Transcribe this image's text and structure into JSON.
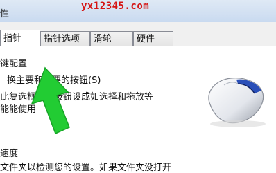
{
  "window": {
    "title_fragment": "性"
  },
  "watermark": "yx12345.com",
  "tabs": [
    {
      "label": "指针"
    },
    {
      "label": "指针选项"
    },
    {
      "label": "滑轮"
    },
    {
      "label": "硬件"
    }
  ],
  "button_config": {
    "group_label": "键配置",
    "switch_label": "换主要和次要的按钮(S)",
    "description_line1": "此复选框将右按钮设成如选择和拖放等",
    "description_line2": "能能使用"
  },
  "speed": {
    "group_label": "速度",
    "description_fragment": "文件夹以检测您的设置。如果文件夹没打开"
  },
  "icons": {
    "mouse": "mouse-icon",
    "pointer": "green-arrow-icon"
  },
  "colors": {
    "watermark": "#d51414",
    "arrow": "#22cc33",
    "mouse_accent": "#2a4fb8"
  }
}
